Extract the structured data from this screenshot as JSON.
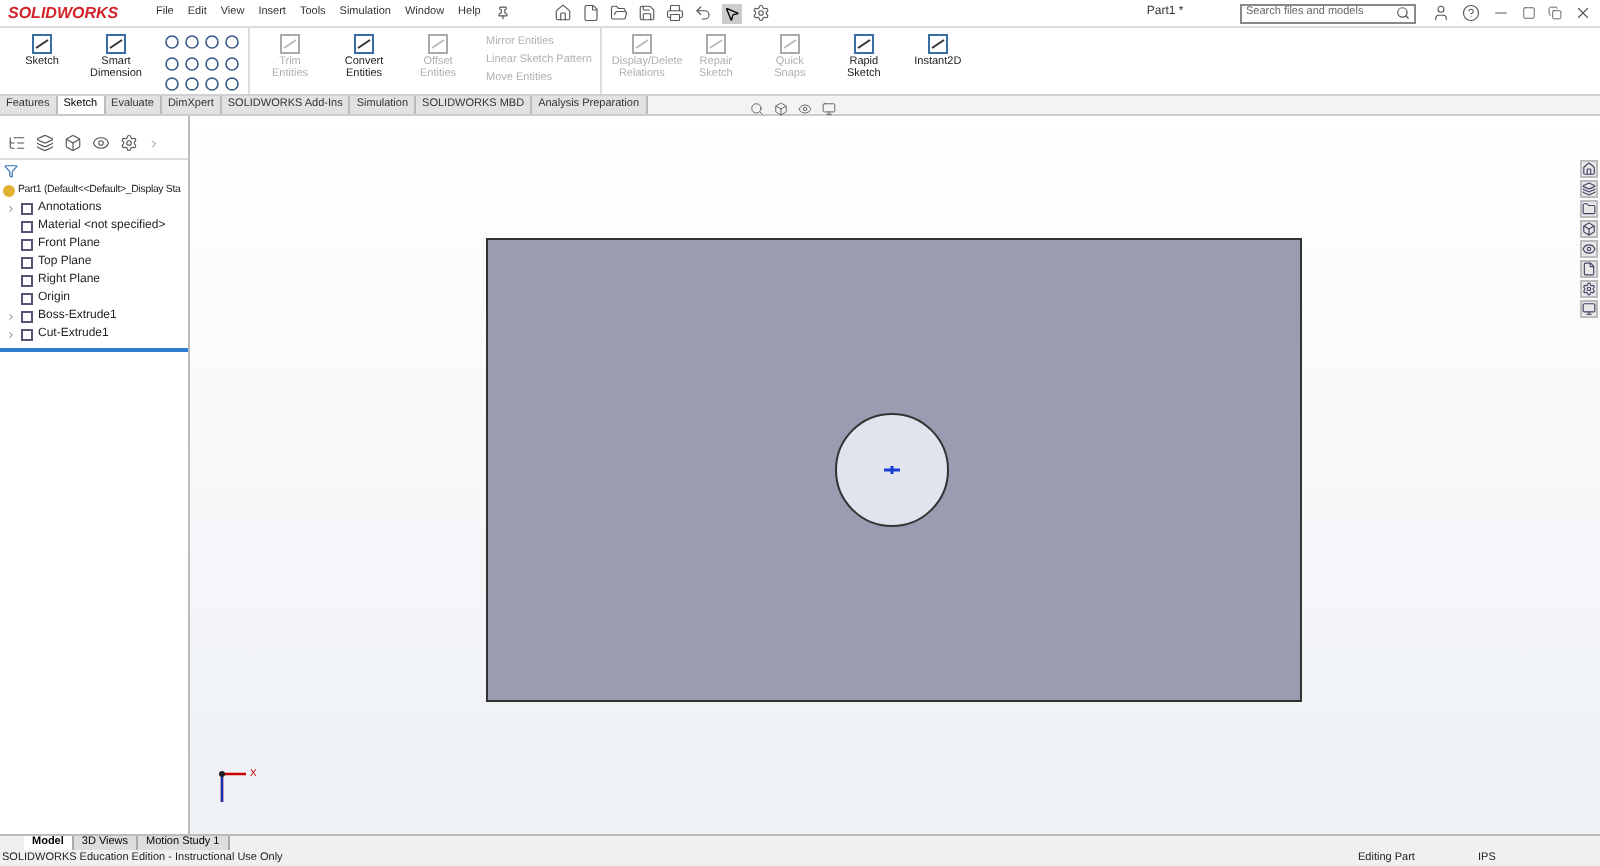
{
  "app": {
    "logo": "SOLIDWORKS",
    "title": "Part1 *"
  },
  "menu": [
    "File",
    "Edit",
    "View",
    "Insert",
    "Tools",
    "Simulation",
    "Window",
    "Help"
  ],
  "search": {
    "placeholder": "Search files and models"
  },
  "ribbon": [
    {
      "kind": "tool",
      "label": "Sketch",
      "disabled": false
    },
    {
      "kind": "tool",
      "label": "Smart Dimension",
      "disabled": false
    },
    {
      "kind": "grid"
    },
    {
      "kind": "tool",
      "label": "Trim Entities",
      "disabled": true
    },
    {
      "kind": "tool",
      "label": "Convert Entities",
      "disabled": false
    },
    {
      "kind": "tool",
      "label": "Offset Entities",
      "disabled": true
    },
    {
      "kind": "stack",
      "entries": [
        {
          "label": "Mirror Entities",
          "disabled": true
        },
        {
          "label": "Linear Sketch Pattern",
          "disabled": true
        },
        {
          "label": "Move Entities",
          "disabled": true
        }
      ]
    },
    {
      "kind": "tool",
      "label": "Display/Delete Relations",
      "disabled": true
    },
    {
      "kind": "tool",
      "label": "Repair Sketch",
      "disabled": true
    },
    {
      "kind": "tool",
      "label": "Quick Snaps",
      "disabled": true
    },
    {
      "kind": "tool",
      "label": "Rapid Sketch",
      "disabled": false
    },
    {
      "kind": "tool",
      "label": "Instant2D",
      "disabled": false
    }
  ],
  "tabs": [
    {
      "label": "Features",
      "selected": false
    },
    {
      "label": "Sketch",
      "selected": true
    },
    {
      "label": "Evaluate",
      "selected": false
    },
    {
      "label": "DimXpert",
      "selected": false
    },
    {
      "label": "SOLIDWORKS Add-Ins",
      "selected": false
    },
    {
      "label": "Simulation",
      "selected": false
    },
    {
      "label": "SOLIDWORKS MBD",
      "selected": false
    },
    {
      "label": "Analysis Preparation",
      "selected": false
    }
  ],
  "tree": {
    "label": "Part1  (Default<<Default>_Display Sta",
    "children": [
      {
        "label": "Annotations",
        "expandable": true
      },
      {
        "label": "Material <not specified>",
        "expandable": false
      },
      {
        "label": "Front Plane",
        "expandable": false
      },
      {
        "label": "Top Plane",
        "expandable": false
      },
      {
        "label": "Right Plane",
        "expandable": false
      },
      {
        "label": "Origin",
        "expandable": false
      },
      {
        "label": "Boss-Extrude1",
        "expandable": true
      },
      {
        "label": "Cut-Extrude1",
        "expandable": true
      }
    ]
  },
  "canvas": {
    "triad_label": "X"
  },
  "bottom_tabs": [
    {
      "label": "Model",
      "selected": true
    },
    {
      "label": "3D Views",
      "selected": false
    },
    {
      "label": "Motion Study 1",
      "selected": false
    }
  ],
  "status_bar": {
    "message": "SOLIDWORKS Education Edition - Instructional Use Only",
    "mode": "Editing Part",
    "units": "IPS"
  }
}
